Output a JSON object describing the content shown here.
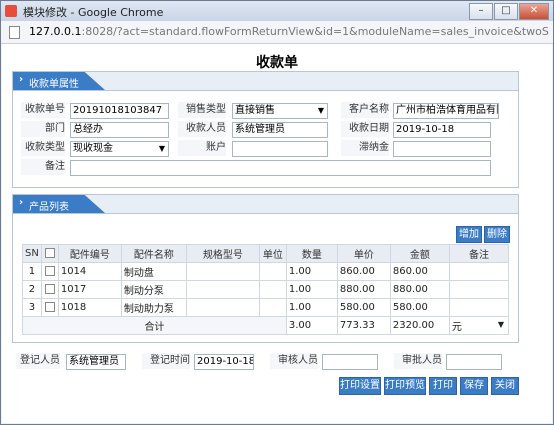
{
  "window": {
    "title": "模块修改 - Google Chrome",
    "url_host": "127.0.0.1",
    "url_rest": ":8028/?act=standard.flowFormReturnView&id=1&moduleName=sales_invoice&twoSubModul..."
  },
  "page_title": "收款单",
  "section1": {
    "title": "收款单属性",
    "fields": {
      "receipt_no_label": "收款单号",
      "receipt_no": "20191018103847",
      "sales_type_label": "销售类型",
      "sales_type": "直接销售",
      "customer_label": "客户名称",
      "customer": "广州市柏浩体育用品有限",
      "dept_label": "部门",
      "dept": "总经办",
      "collector_label": "收款人员",
      "collector": "系统管理员",
      "date_label": "收款日期",
      "date": "2019-10-18",
      "receipt_type_label": "收款类型",
      "receipt_type": "现收现金",
      "account_label": "账户",
      "account": "",
      "discount_label": "滞纳金",
      "discount": "",
      "remark_label": "备注",
      "remark": ""
    }
  },
  "section2": {
    "title": "产品列表",
    "add_label": "增加",
    "delete_label": "删除",
    "columns": [
      "SN",
      "",
      "配件编号",
      "配件名称",
      "规格型号",
      "单位",
      "数量",
      "单价",
      "金额",
      "备注"
    ],
    "rows": [
      {
        "sn": "1",
        "code": "1014",
        "name": "制动盘",
        "spec": "",
        "unit": "",
        "qty": "1.00",
        "price": "860.00",
        "amount": "860.00",
        "note": ""
      },
      {
        "sn": "2",
        "code": "1017",
        "name": "制动分泵",
        "spec": "",
        "unit": "",
        "qty": "1.00",
        "price": "880.00",
        "amount": "880.00",
        "note": ""
      },
      {
        "sn": "3",
        "code": "1018",
        "name": "制动助力泵",
        "spec": "",
        "unit": "",
        "qty": "1.00",
        "price": "580.00",
        "amount": "580.00",
        "note": ""
      }
    ],
    "total_label": "合计",
    "total_qty": "3.00",
    "total_price": "773.33",
    "total_amount": "2320.00",
    "currency": "元"
  },
  "footer": {
    "registrar_label": "登记人员",
    "registrar": "系统管理员",
    "reg_time_label": "登记时间",
    "reg_time": "2019-10-18",
    "reviewer_label": "审核人员",
    "reviewer": "",
    "approver_label": "审批人员",
    "approver": ""
  },
  "buttons": {
    "print_setup": "打印设置",
    "print_preview": "打印预览",
    "print": "打印",
    "save": "保存",
    "close": "关闭"
  },
  "icons": {
    "app": "app-icon",
    "minimize": "minimize-icon",
    "maximize": "maximize-icon",
    "close": "close-icon",
    "page": "page-icon"
  },
  "colors": {
    "accent": "#3b7cc7"
  }
}
